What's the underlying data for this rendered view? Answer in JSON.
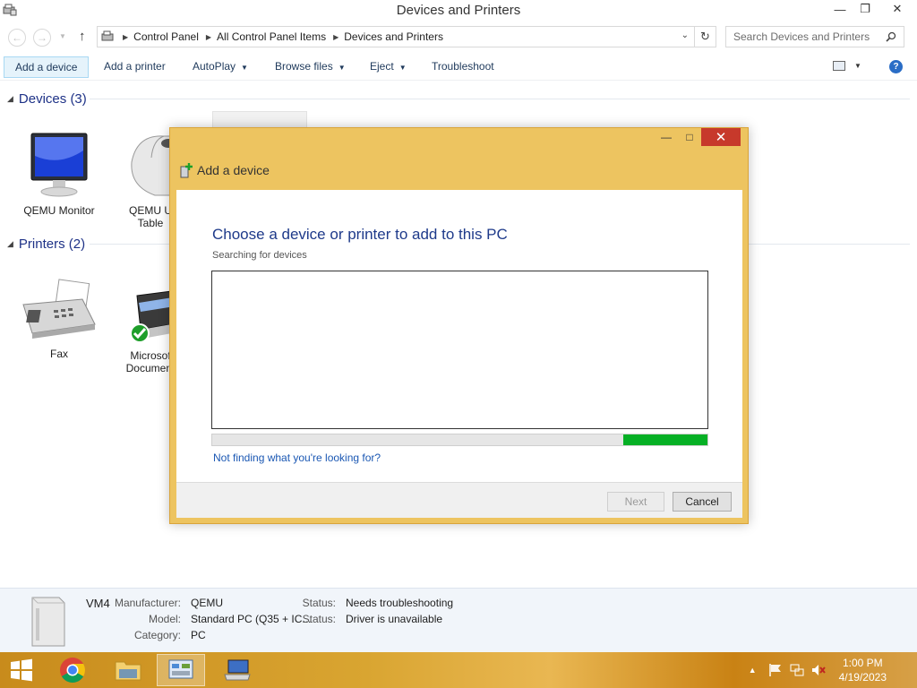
{
  "window": {
    "title": "Devices and Printers"
  },
  "address": {
    "breadcrumbs": [
      "Control Panel",
      "All Control Panel Items",
      "Devices and Printers"
    ],
    "search_placeholder": "Search Devices and Printers"
  },
  "toolbar": {
    "items": [
      {
        "label": "Add a device",
        "has_caret": false
      },
      {
        "label": "Add a printer",
        "has_caret": false
      },
      {
        "label": "AutoPlay",
        "has_caret": true
      },
      {
        "label": "Browse files",
        "has_caret": true
      },
      {
        "label": "Eject",
        "has_caret": true
      },
      {
        "label": "Troubleshoot",
        "has_caret": false
      }
    ]
  },
  "groups": {
    "devices": {
      "header": "Devices (3)",
      "items": [
        {
          "label": "QEMU Monitor",
          "icon": "monitor-icon"
        },
        {
          "label": "QEMU U",
          "label2": "Table",
          "icon": "mouse-icon"
        }
      ]
    },
    "printers": {
      "header": "Printers (2)",
      "items": [
        {
          "label": "Fax",
          "icon": "fax-icon"
        },
        {
          "label": "Microsof",
          "label2": "Document",
          "icon": "printer-icon"
        }
      ]
    }
  },
  "details": {
    "device_name": "VM4",
    "manufacturer_label": "Manufacturer:",
    "manufacturer": "QEMU",
    "model_label": "Model:",
    "model": "Standard PC (Q35 + IC...",
    "category_label": "Category:",
    "category": "PC",
    "status_label": "Status:",
    "status1": "Needs troubleshooting",
    "status2": "Driver is unavailable"
  },
  "dialog": {
    "title": "Add a device",
    "headline": "Choose a device or printer to add to this PC",
    "subtext": "Searching for devices",
    "progress": {
      "indeterminate_segment_start": 0.83,
      "indeterminate_segment_end": 1.0
    },
    "link": "Not finding what you're looking for?",
    "next_label": "Next",
    "cancel_label": "Cancel"
  },
  "taskbar": {
    "time": "1:00 PM",
    "date": "4/19/2023"
  },
  "colors": {
    "dialog_frame": "#edc460",
    "progress_fill": "#06b025",
    "headline": "#1e3a8a",
    "group_header": "#1e3287"
  }
}
